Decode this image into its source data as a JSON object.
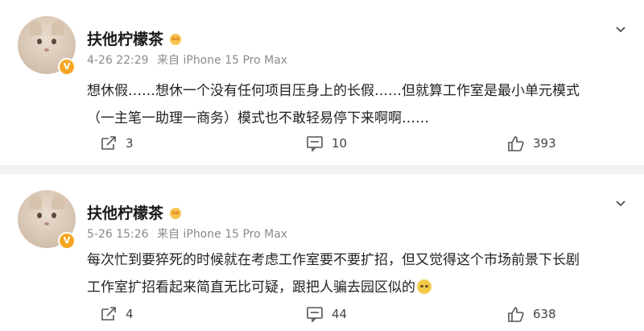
{
  "posts": [
    {
      "username": "扶他柠檬茶",
      "date": "4-26 22:29",
      "source": "来自 iPhone 15 Pro Max",
      "content_line1": "想休假……想休一个没有任何项目压身上的长假……但就算工作室是最小单元模式",
      "content_line2": "（一主笔一助理一商务）模式也不敢轻易停下来啊啊……",
      "reposts": "3",
      "comments": "10",
      "likes": "393"
    },
    {
      "username": "扶他柠檬茶",
      "date": "5-26 15:26",
      "source": "来自 iPhone 15 Pro Max",
      "content_line1": "每次忙到要猝死的时候就在考虑工作室要不要扩招，但又觉得这个市场前景下长剧",
      "content_line2": "工作室扩招看起来简直无比可疑，跟把人骗去园区似的",
      "reposts": "4",
      "comments": "44",
      "likes": "638"
    }
  ],
  "icons": {
    "avatar_badge": "V",
    "crown": "crown-icon",
    "chevron": "chevron-down-icon",
    "repost": "repost-icon",
    "comment": "comment-icon",
    "like": "like-icon",
    "emoji": "sweat-smile-emoji"
  },
  "colors": {
    "badge": "#f7a623",
    "meta_text": "#8a8a8a",
    "background": "#f2f2f2"
  }
}
